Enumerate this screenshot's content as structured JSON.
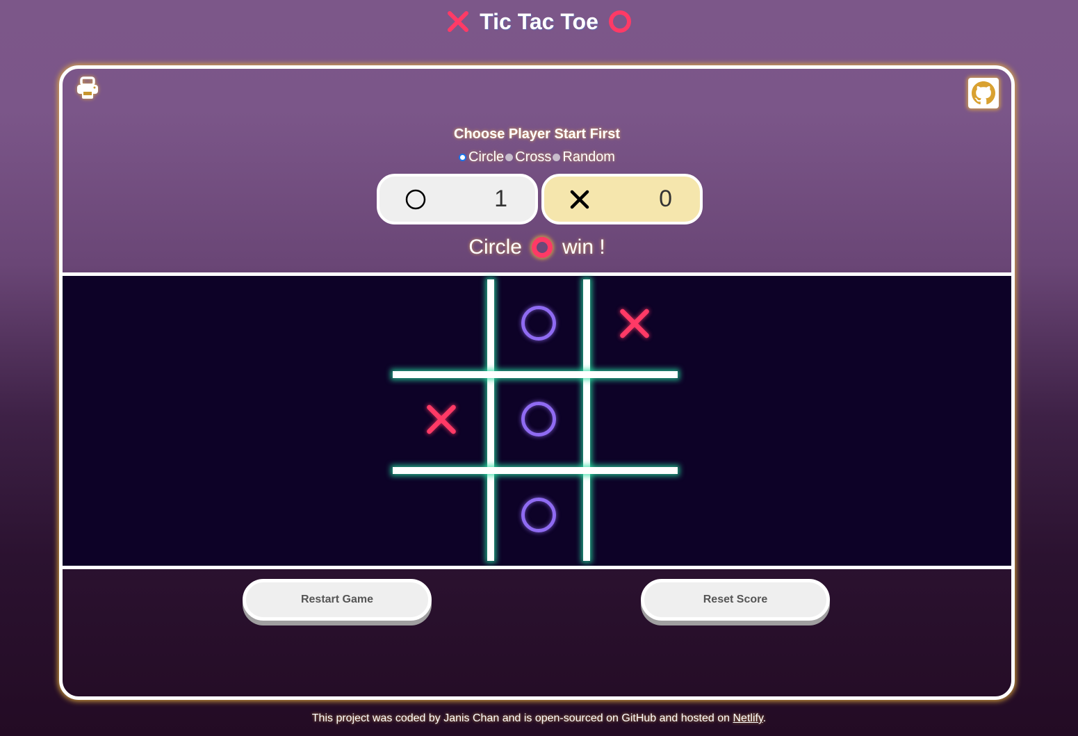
{
  "header": {
    "title": "Tic Tac Toe",
    "left_icon": "cross-icon",
    "right_icon": "circle-icon"
  },
  "toolbar": {
    "print_icon": "printer-icon",
    "github_icon": "github-icon"
  },
  "start_player": {
    "title": "Choose Player Start First",
    "options": [
      {
        "label": "Circle",
        "checked": true
      },
      {
        "label": "Cross",
        "checked": false
      },
      {
        "label": "Random",
        "checked": false
      }
    ]
  },
  "score": {
    "circle": {
      "icon": "circle-icon",
      "value": "1"
    },
    "cross": {
      "icon": "cross-icon",
      "value": "0",
      "active": true
    }
  },
  "status": {
    "prefix": "Circle",
    "icon": "circle-icon",
    "suffix": "win !"
  },
  "board": {
    "cells": [
      "",
      "O",
      "X",
      "X",
      "O",
      "",
      "",
      "O",
      ""
    ],
    "colors": {
      "grid_glow": "#28dca0",
      "circle": "#8f6bf2",
      "cross": "#ff3a66",
      "background": "#0d0227"
    }
  },
  "actions": {
    "restart_label": "Restart Game",
    "reset_label": "Reset Score"
  },
  "footer": {
    "text": "This project was coded by Janis Chan and is open-sourced on GitHub and hosted on ",
    "link_label": "Netlify",
    "end": "."
  },
  "colors": {
    "accent_red": "#ff3a66",
    "glow_gold": "#e8b03c",
    "cross_score_bg": "#f5e6ad"
  }
}
